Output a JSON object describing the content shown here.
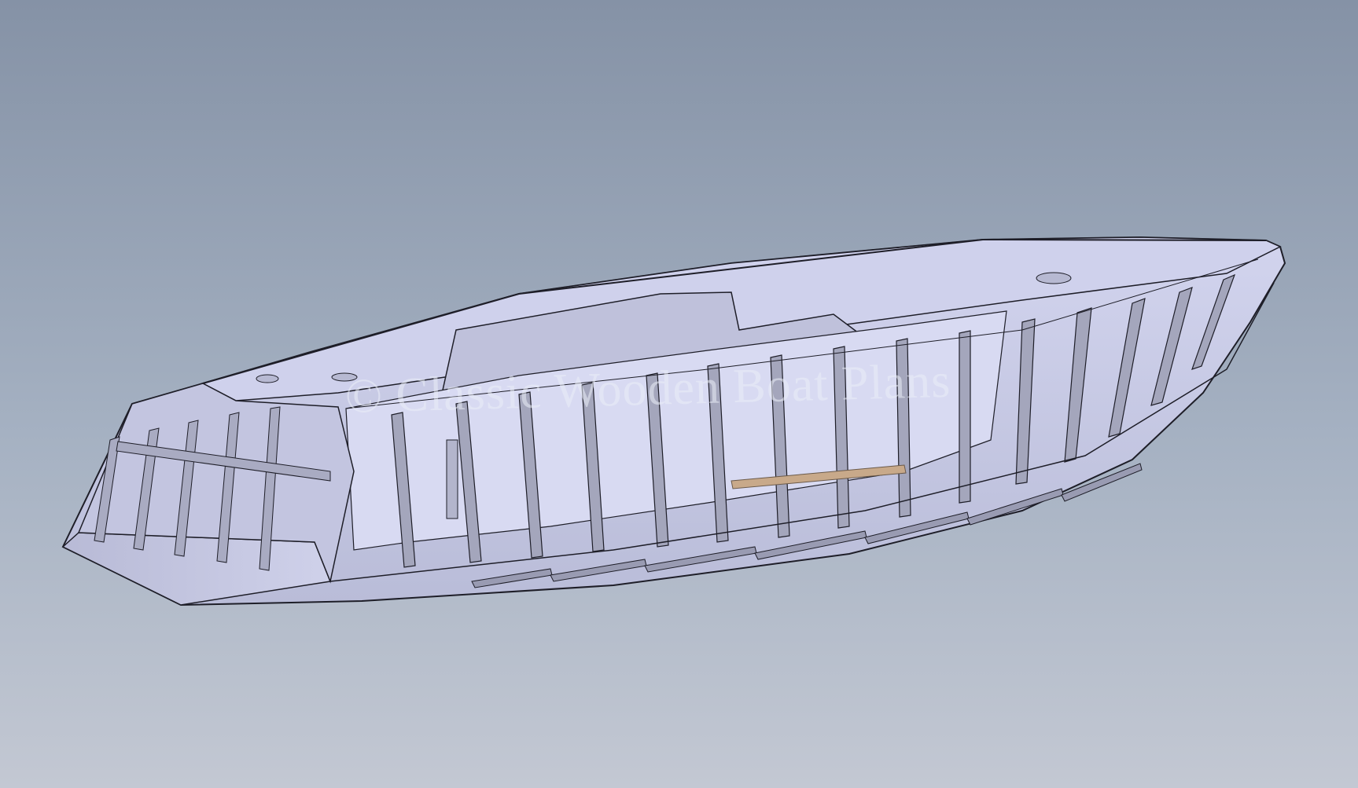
{
  "watermark": {
    "text": "© Classic Wooden Boat Plans"
  },
  "model": {
    "subject": "boat-hull-frames-icon",
    "colors": {
      "background_top": "#8592a6",
      "background_bottom": "#c3c8d3",
      "hull_fill": "#c9cbe6",
      "frame_fill": "#a4a6bc",
      "interior_fill": "#d8daf2",
      "outline": "#1e1e28",
      "wood_accent": "#c8a98a"
    }
  }
}
